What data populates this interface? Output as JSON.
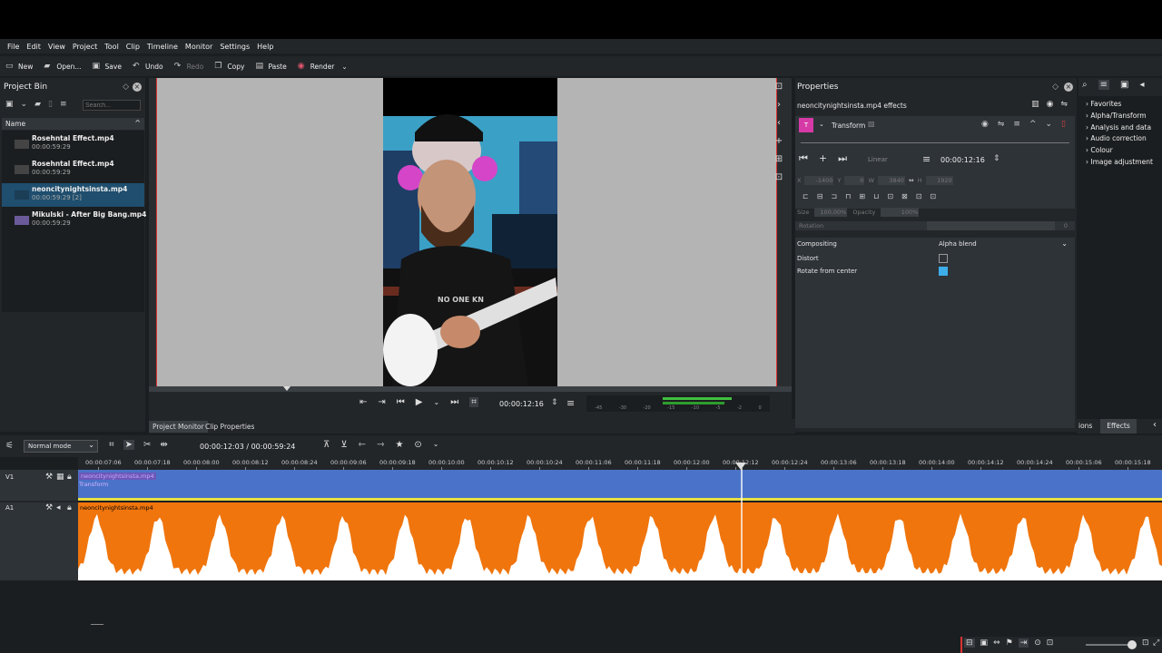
{
  "menu": [
    "File",
    "Edit",
    "View",
    "Project",
    "Tool",
    "Clip",
    "Timeline",
    "Monitor",
    "Settings",
    "Help"
  ],
  "toolbar": {
    "new": "New",
    "open": "Open...",
    "save": "Save",
    "undo": "Undo",
    "redo": "Redo",
    "copy": "Copy",
    "paste": "Paste",
    "render": "Render"
  },
  "bin": {
    "title": "Project Bin",
    "search_placeholder": "Search...",
    "column": "Name",
    "items": [
      {
        "name": "Rosehntal Effect.mp4",
        "duration": "00:00:59:29"
      },
      {
        "name": "Rosehntal Effect.mp4",
        "duration": "00:00:59:29"
      },
      {
        "name": "neoncitynightsinsta.mp4",
        "duration": "00:00:59:29 [2]"
      },
      {
        "name": "Mikulski - After Big Bang.mp4",
        "duration": "00:00:59:29"
      }
    ]
  },
  "monitor": {
    "timecode": "00:00:12:16",
    "meter_labels": [
      "-45",
      "-30",
      "-20",
      "-15",
      "-10",
      "-5",
      "-2",
      "0"
    ],
    "shirt_text": "NO ONE KN"
  },
  "tabs": {
    "project_monitor": "Project Monitor",
    "clip_properties": "Clip Properties"
  },
  "properties": {
    "title": "Properties",
    "subtitle": "neoncitynightsinsta.mp4 effects",
    "effect_name": "Transform",
    "keyframe_mode": "Linear",
    "timecode": "00:00:12:16",
    "x_label": "X",
    "x_value": "-1400",
    "y_label": "Y",
    "y_value": "0",
    "w_label": "W",
    "w_value": "3840",
    "h_label": "H",
    "h_value": "1920",
    "size_label": "Size",
    "size_value": "100,00%",
    "opacity_label": "Opacity",
    "opacity_value": "100%",
    "rotation_label": "Rotation",
    "rotation_value": "0",
    "compositing_label": "Compositing",
    "compositing_value": "Alpha blend",
    "distort_label": "Distort",
    "rotate_label": "Rotate from center"
  },
  "effects": {
    "items": [
      "Favorites",
      "Alpha/Transform",
      "Analysis and data",
      "Audio correction",
      "Colour",
      "Image adjustment"
    ],
    "tab_left": "ions",
    "tab": "Effects"
  },
  "timeline": {
    "mode": "Normal mode",
    "position": "00:00:12:03 / 00:00:59:24",
    "ruler": [
      "00:00:07:06",
      "00:00:07:18",
      "00:00:08:00",
      "00:00:08:12",
      "00:00:08:24",
      "00:00:09:06",
      "00:00:09:18",
      "00:00:10:00",
      "00:00:10:12",
      "00:00:10:24",
      "00:00:11:06",
      "00:00:11:18",
      "00:00:12:00",
      "00:00:12:12",
      "00:00:12:24",
      "00:00:13:06",
      "00:00:13:18",
      "00:00:14:00",
      "00:00:14:12",
      "00:00:14:24",
      "00:00:15:06",
      "00:00:15:18"
    ],
    "v_track": "V1",
    "a_track": "A1",
    "v_clip": "neoncitynightsinsta.mp4",
    "v_effect": "Transform",
    "a_clip": "neoncitynightsinsta.mp4"
  },
  "colors": {
    "accent": "#3daee9",
    "video_track": "#4a72c8",
    "audio_track": "#f0750d",
    "panel": "#232629"
  }
}
